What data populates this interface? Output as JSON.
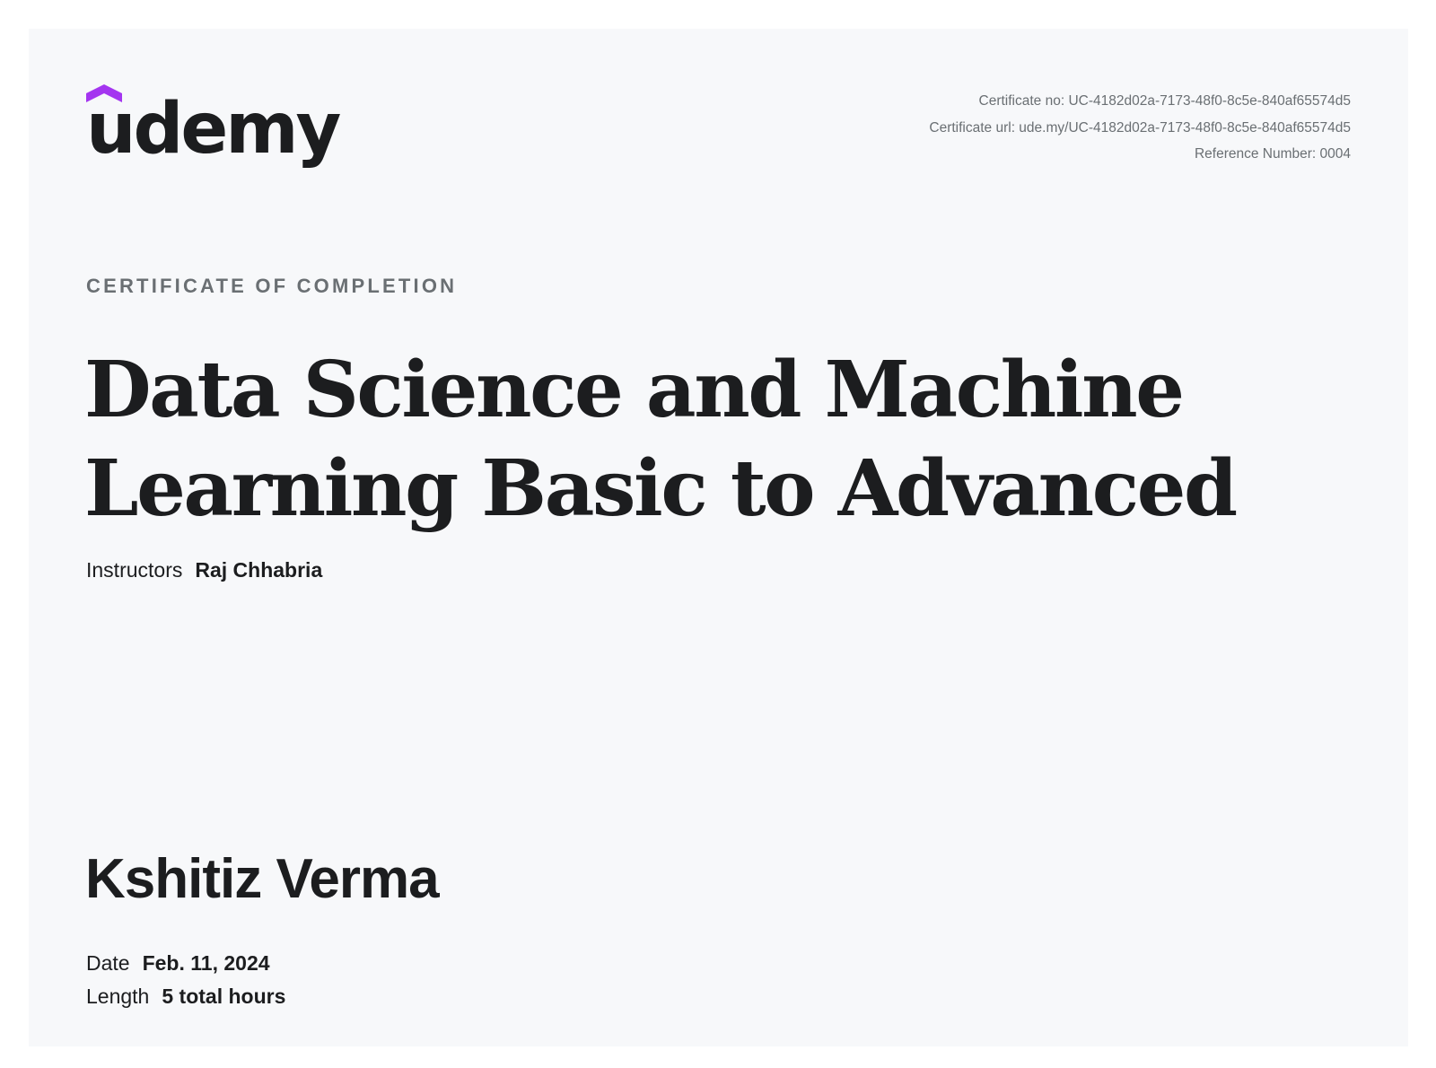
{
  "brand": {
    "wordmark": "udemy",
    "icon": "graduation-cap-icon",
    "accent_color": "#a435f0"
  },
  "certificate_meta": {
    "certificate_no": "Certificate no: UC-4182d02a-7173-48f0-8c5e-840af65574d5",
    "certificate_url": "Certificate url: ude.my/UC-4182d02a-7173-48f0-8c5e-840af65574d5",
    "reference_number": "Reference Number: 0004"
  },
  "eyebrow": "CERTIFICATE OF COMPLETION",
  "course": {
    "title_lines": [
      "Data Science and Machine",
      "Learning Basic to Advanced"
    ]
  },
  "instructors": {
    "label": "Instructors",
    "names": "Raj Chhabria"
  },
  "recipient": {
    "name": "Kshitiz Verma"
  },
  "details": {
    "date_label": "Date",
    "date_value": "Feb. 11, 2024",
    "length_label": "Length",
    "length_value": "5 total hours"
  },
  "colors": {
    "background": "#f7f8fa",
    "text_primary": "#1c1d1f",
    "text_secondary": "#6a6f73"
  }
}
